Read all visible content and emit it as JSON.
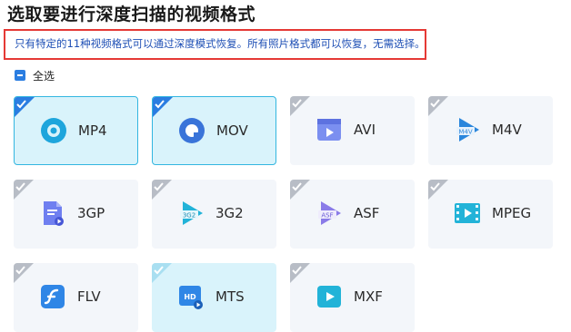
{
  "page": {
    "title": "选取要进行深度扫描的视频格式",
    "notice": "只有特定的11种视频格式可以通过深度模式恢复。所有照片格式都可以恢复，无需选择。",
    "select_all_label": "全选"
  },
  "colors": {
    "accent": "#2a7de1",
    "selected_border": "#33b6e0",
    "selected_bg": "#d9f3fb",
    "card_bg": "#f3f6fa",
    "notice_border": "#e53935",
    "notice_text": "#1e4fb5"
  },
  "formats": [
    {
      "label": "MP4",
      "icon": "mp4-icon",
      "state": "selected"
    },
    {
      "label": "MOV",
      "icon": "mov-icon",
      "state": "selected"
    },
    {
      "label": "AVI",
      "icon": "avi-icon",
      "state": "unselected"
    },
    {
      "label": "M4V",
      "icon": "m4v-icon",
      "state": "unselected",
      "badge": "M4V"
    },
    {
      "label": "3GP",
      "icon": "3gp-icon",
      "state": "unselected"
    },
    {
      "label": "3G2",
      "icon": "3g2-icon",
      "state": "unselected",
      "badge": "3G2"
    },
    {
      "label": "ASF",
      "icon": "asf-icon",
      "state": "unselected",
      "badge": "ASF"
    },
    {
      "label": "MPEG",
      "icon": "mpeg-icon",
      "state": "unselected"
    },
    {
      "label": "FLV",
      "icon": "flv-icon",
      "state": "unselected"
    },
    {
      "label": "MTS",
      "icon": "mts-icon",
      "state": "light",
      "badge": "HD"
    },
    {
      "label": "MXF",
      "icon": "mxf-icon",
      "state": "unselected"
    }
  ]
}
